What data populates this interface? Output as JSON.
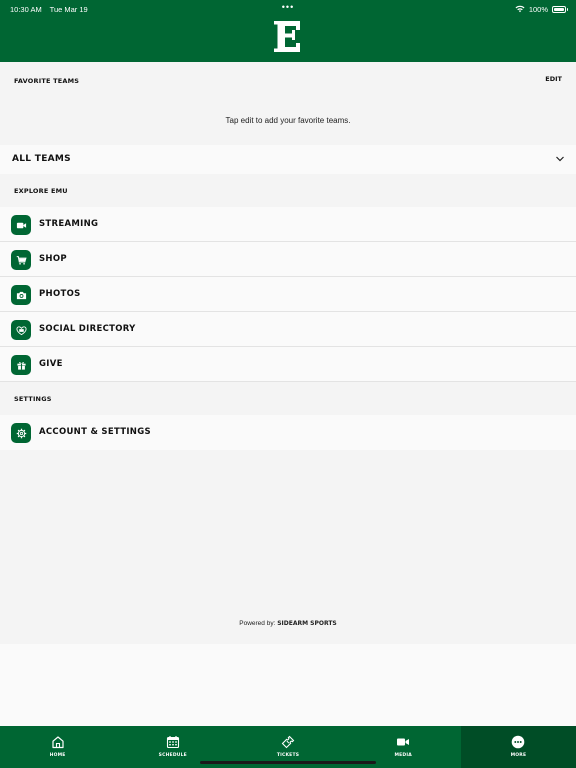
{
  "status_bar": {
    "time": "10:30 AM",
    "date": "Tue Mar 19",
    "dots": "•••",
    "battery": "100%"
  },
  "header": {
    "logo_letter": "E"
  },
  "favorites": {
    "title": "FAVORITE TEAMS",
    "edit_label": "EDIT",
    "empty_text": "Tap edit to add your favorite teams."
  },
  "all_teams": {
    "label": "ALL TEAMS"
  },
  "explore": {
    "title": "EXPLORE EMU",
    "items": [
      {
        "label": "STREAMING",
        "icon": "video-camera-icon"
      },
      {
        "label": "SHOP",
        "icon": "shopping-cart-icon"
      },
      {
        "label": "PHOTOS",
        "icon": "camera-icon"
      },
      {
        "label": "SOCIAL DIRECTORY",
        "icon": "social-icon"
      },
      {
        "label": "GIVE",
        "icon": "gift-icon"
      }
    ]
  },
  "settings": {
    "title": "SETTINGS",
    "items": [
      {
        "label": "ACCOUNT & SETTINGS",
        "icon": "gear-icon"
      }
    ]
  },
  "footer": {
    "powered_prefix": "Powered by:",
    "powered_brand": "SIDEARM SPORTS"
  },
  "tabbar": {
    "active": "MORE",
    "tabs": [
      {
        "label": "HOME",
        "icon": "home-icon"
      },
      {
        "label": "SCHEDULE",
        "icon": "calendar-icon"
      },
      {
        "label": "TICKETS",
        "icon": "ticket-icon"
      },
      {
        "label": "MEDIA",
        "icon": "video-camera-icon"
      },
      {
        "label": "MORE",
        "icon": "more-icon"
      }
    ]
  },
  "colors": {
    "brand_green": "#006633",
    "active_tab": "#004d26",
    "background": "#f4f4f4",
    "row_background": "#fafafa"
  }
}
